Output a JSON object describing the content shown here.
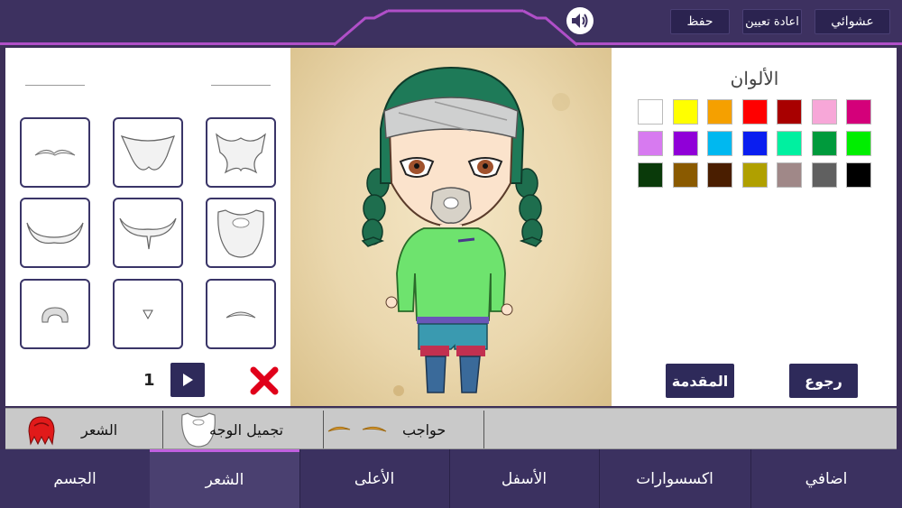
{
  "topbar": {
    "random_label": "عشوائي",
    "reset_label": "اعادة تعيين",
    "save_label": "حفظ",
    "sound_icon": "speaker-icon"
  },
  "left_panel": {
    "page_number": "1",
    "items": [
      {
        "icon": "eyebrow-thin"
      },
      {
        "icon": "beard-wide"
      },
      {
        "icon": "beard-goatee"
      },
      {
        "icon": "mustache-long"
      },
      {
        "icon": "mustache-braid"
      },
      {
        "icon": "beard-full"
      },
      {
        "icon": "beard-chinstrap"
      },
      {
        "icon": "soul-patch"
      },
      {
        "icon": "eyebrow-arch"
      }
    ]
  },
  "right_panel": {
    "colors_title": "الألوان",
    "colors": [
      "#ffffff",
      "#ffff00",
      "#f5a000",
      "#ff0000",
      "#a80000",
      "#f7a7d8",
      "#d4007a",
      "#d77af0",
      "#9000d8",
      "#00b8f0",
      "#0a1ef0",
      "#00f0a0",
      "#009a3c",
      "#00ee00",
      "#0a3a0a",
      "#8a5a00",
      "#4a1e00",
      "#b0a000",
      "#a08888",
      "#606060",
      "#000000"
    ],
    "back_label": "رجوع",
    "intro_label": "المقدمة"
  },
  "subtabs": [
    {
      "label": "الشعر",
      "icon": "hair-icon"
    },
    {
      "label": "تجميل الوجه",
      "icon": "beard-icon"
    },
    {
      "label": "حواجب",
      "icon": "eyebrows-icon"
    }
  ],
  "bottom_tabs": [
    {
      "label": "الجسم",
      "active": false
    },
    {
      "label": "الشعر",
      "active": true
    },
    {
      "label": "الأعلى",
      "active": false
    },
    {
      "label": "الأسفل",
      "active": false
    },
    {
      "label": "اكسسوارات",
      "active": false
    },
    {
      "label": "اضافي",
      "active": false
    }
  ],
  "theme": {
    "primary": "#2e2a5a",
    "bar": "#3b3160",
    "accent": "#c060e0",
    "delete": "#e0001a"
  }
}
